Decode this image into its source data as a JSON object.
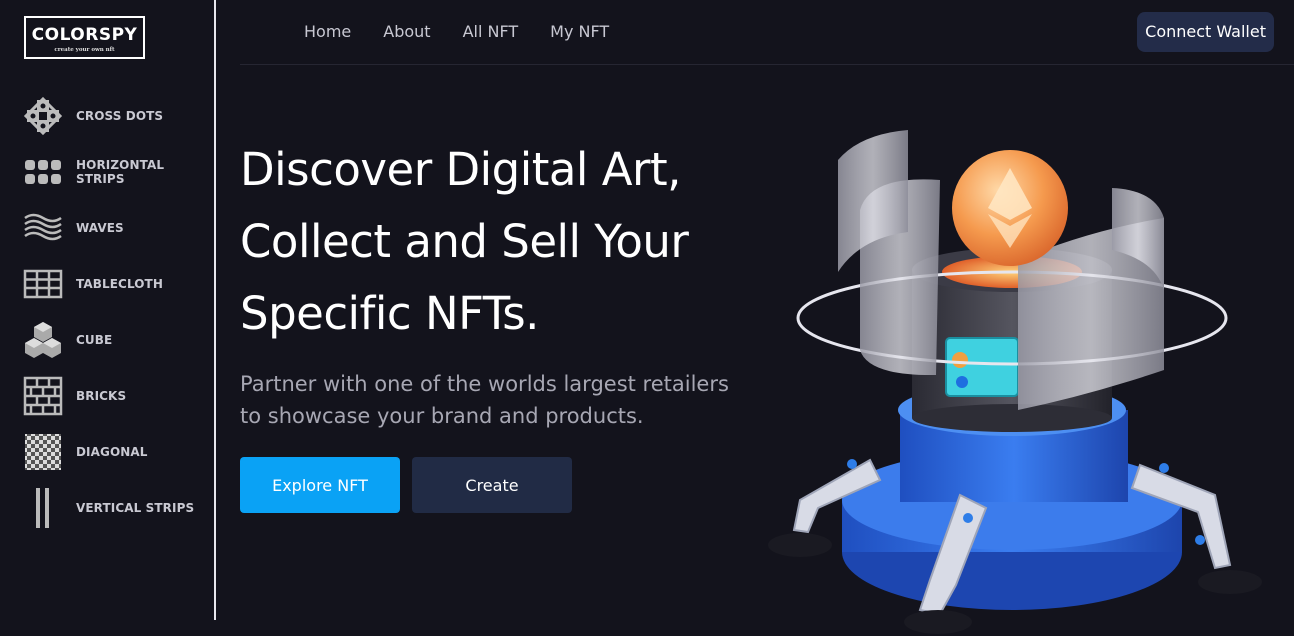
{
  "brand": {
    "title": "COLORSPY",
    "tagline": "create your own nft"
  },
  "sidebar": {
    "items": [
      {
        "label": "CROSS DOTS",
        "icon": "cross-dots-icon"
      },
      {
        "label": "HORIZONTAL STRIPS",
        "icon": "horizontal-strips-icon"
      },
      {
        "label": "WAVES",
        "icon": "waves-icon"
      },
      {
        "label": "TABLECLOTH",
        "icon": "tablecloth-icon"
      },
      {
        "label": "CUBE",
        "icon": "cube-icon"
      },
      {
        "label": "BRICKS",
        "icon": "bricks-icon"
      },
      {
        "label": "DIAGONAL",
        "icon": "diagonal-icon"
      },
      {
        "label": "VERTICAL STRIPS",
        "icon": "vertical-strips-icon"
      }
    ]
  },
  "nav": {
    "links": [
      "Home",
      "About",
      "All NFT",
      "My NFT"
    ],
    "wallet_label": "Connect Wallet"
  },
  "hero": {
    "title_lines": [
      "Discover Digital Art,",
      "Collect and Sell Your",
      "Specific NFTs."
    ],
    "subtitle_lines": [
      "Partner with one of the worlds largest retailers",
      "to showcase your brand and products."
    ],
    "primary_label": "Explore NFT",
    "secondary_label": "Create"
  },
  "colors": {
    "background": "#13131c",
    "primary_button": "#0aa2f5",
    "secondary_button": "#212b45",
    "wallet_button": "#232c49"
  }
}
